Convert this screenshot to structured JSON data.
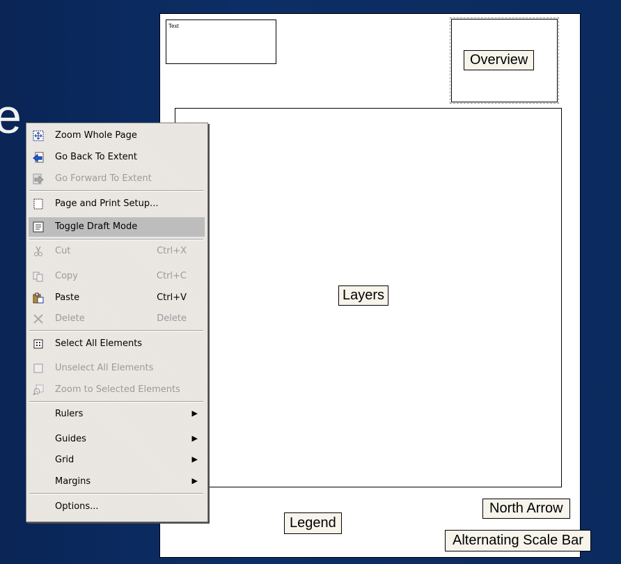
{
  "layout_page": {
    "text_box_label": "Text",
    "overview_label": "Overview",
    "layers_label": "Layers",
    "legend_label": "Legend",
    "north_arrow_label": "North Arrow",
    "scale_bar_label": "Alternating Scale Bar"
  },
  "background_glyph": "e",
  "context_menu": {
    "items": [
      {
        "label": "Zoom Whole Page",
        "icon": "zoom-whole-page-icon",
        "enabled": true
      },
      {
        "label": "Go Back To Extent",
        "icon": "go-back-icon",
        "enabled": true
      },
      {
        "label": "Go Forward To Extent",
        "icon": "go-forward-icon",
        "enabled": false
      },
      {
        "label": "Page and Print Setup...",
        "icon": "page-setup-icon",
        "enabled": true
      },
      {
        "label": "Toggle Draft Mode",
        "icon": "draft-mode-icon",
        "enabled": true,
        "highlighted": true
      },
      {
        "label": "Cut",
        "shortcut": "Ctrl+X",
        "icon": "scissors-icon",
        "enabled": false
      },
      {
        "label": "Copy",
        "shortcut": "Ctrl+C",
        "icon": "copy-icon",
        "enabled": false
      },
      {
        "label": "Paste",
        "shortcut": "Ctrl+V",
        "icon": "paste-icon",
        "enabled": true
      },
      {
        "label": "Delete",
        "shortcut": "Delete",
        "icon": "delete-icon",
        "enabled": false
      },
      {
        "label": "Select All Elements",
        "icon": "select-all-icon",
        "enabled": true
      },
      {
        "label": "Unselect All Elements",
        "icon": "unselect-icon",
        "enabled": false
      },
      {
        "label": "Zoom to Selected Elements",
        "icon": "zoom-selected-icon",
        "enabled": false
      },
      {
        "label": "Rulers",
        "submenu": true,
        "enabled": true
      },
      {
        "label": "Guides",
        "submenu": true,
        "enabled": true
      },
      {
        "label": "Grid",
        "submenu": true,
        "enabled": true
      },
      {
        "label": "Margins",
        "submenu": true,
        "enabled": true
      },
      {
        "label": "Options...",
        "enabled": true
      }
    ]
  },
  "colors": {
    "background": "#0b2a5e",
    "menu_bg": "#ebe8e4",
    "highlight": "#bdbdbd",
    "label_bg": "#f7f4ec"
  }
}
